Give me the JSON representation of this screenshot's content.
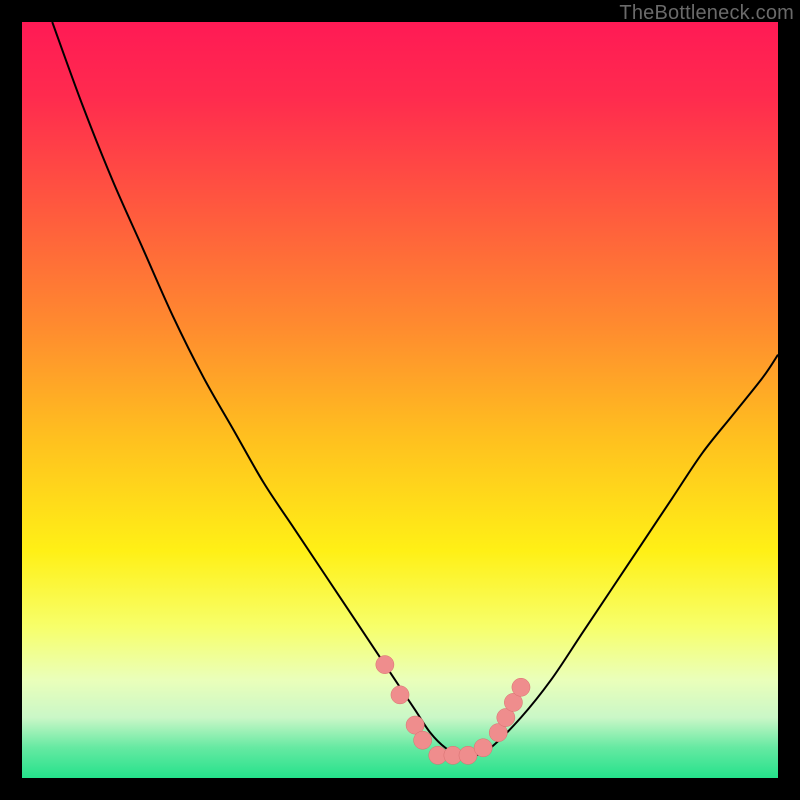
{
  "attribution": "TheBottleneck.com",
  "chart_data": {
    "type": "line",
    "title": "",
    "xlabel": "",
    "ylabel": "",
    "xlim": [
      0,
      100
    ],
    "ylim": [
      0,
      100
    ],
    "background_gradient": {
      "stops": [
        {
          "offset": 0,
          "color": "#ff1a55"
        },
        {
          "offset": 10,
          "color": "#ff2b4e"
        },
        {
          "offset": 25,
          "color": "#ff5a3e"
        },
        {
          "offset": 40,
          "color": "#ff8a2f"
        },
        {
          "offset": 55,
          "color": "#ffc01f"
        },
        {
          "offset": 70,
          "color": "#fff016"
        },
        {
          "offset": 80,
          "color": "#f7ff6a"
        },
        {
          "offset": 87,
          "color": "#eaffba"
        },
        {
          "offset": 92,
          "color": "#caf7c7"
        },
        {
          "offset": 96,
          "color": "#65e9a2"
        },
        {
          "offset": 100,
          "color": "#25e28b"
        }
      ]
    },
    "series": [
      {
        "name": "bottleneck-curve",
        "x": [
          4,
          8,
          12,
          16,
          20,
          24,
          28,
          32,
          36,
          40,
          44,
          48,
          50,
          52,
          54,
          56,
          58,
          60,
          62,
          66,
          70,
          74,
          78,
          82,
          86,
          90,
          94,
          98,
          100
        ],
        "y": [
          100,
          89,
          79,
          70,
          61,
          53,
          46,
          39,
          33,
          27,
          21,
          15,
          12,
          9,
          6,
          4,
          3,
          3,
          4,
          8,
          13,
          19,
          25,
          31,
          37,
          43,
          48,
          53,
          56
        ]
      }
    ],
    "markers": {
      "name": "highlighted-points",
      "points": [
        {
          "x": 48,
          "y": 15
        },
        {
          "x": 50,
          "y": 11
        },
        {
          "x": 52,
          "y": 7
        },
        {
          "x": 53,
          "y": 5
        },
        {
          "x": 55,
          "y": 3
        },
        {
          "x": 57,
          "y": 3
        },
        {
          "x": 59,
          "y": 3
        },
        {
          "x": 61,
          "y": 4
        },
        {
          "x": 63,
          "y": 6
        },
        {
          "x": 64,
          "y": 8
        },
        {
          "x": 65,
          "y": 10
        },
        {
          "x": 66,
          "y": 12
        }
      ]
    }
  }
}
